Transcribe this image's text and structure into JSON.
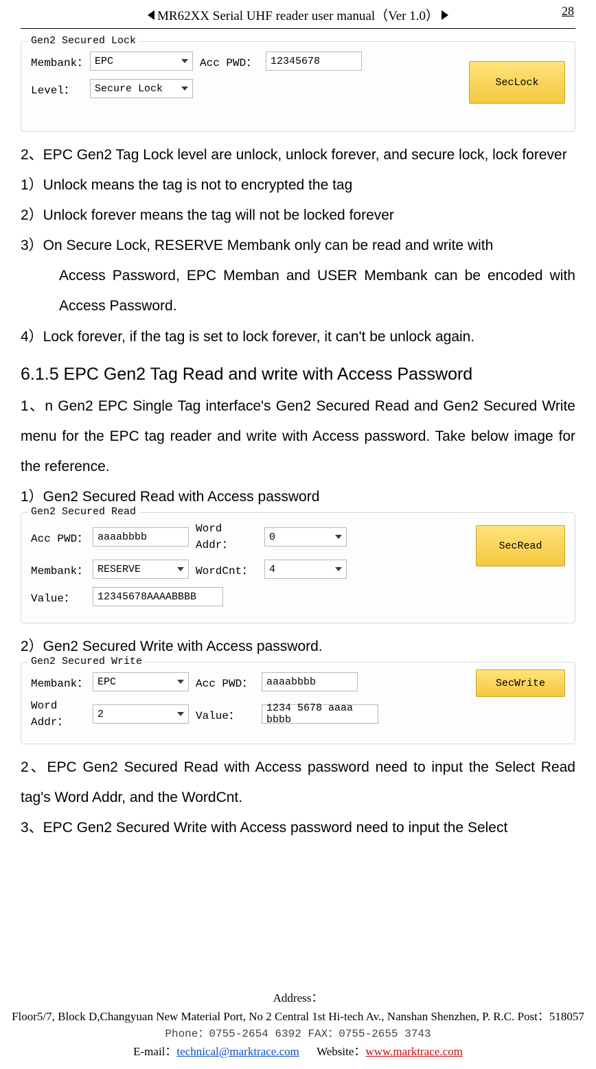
{
  "header": {
    "title": "MR62XX Serial UHF reader user manual（Ver 1.0）",
    "page": "28"
  },
  "panel_lock": {
    "legend": "Gen2 Secured Lock",
    "membank_label": "Membank：",
    "membank_value": "EPC",
    "accpwd_label": "Acc PWD：",
    "accpwd_value": "12345678",
    "level_label": "Level：",
    "level_value": "Secure Lock",
    "button": "SecLock"
  },
  "text": {
    "p1": "2、EPC Gen2 Tag Lock level are unlock, unlock forever, and secure lock, lock forever",
    "l1": "1）Unlock means the tag is not to encrypted the tag",
    "l2": "2）Unlock forever means the tag will not be locked forever",
    "l3a": "3）On Secure Lock, RESERVE Membank only can be read and write with",
    "l3b": "Access Password, EPC Memban and USER Membank can be encoded with Access Password.",
    "l4": "4）Lock forever, if the tag is set to lock forever, it can't be unlock again.",
    "h": "6.1.5 EPC Gen2 Tag Read and write with Access Password",
    "p2": "1、n Gen2 EPC Single Tag interface's Gen2 Secured Read and Gen2 Secured Write menu for the EPC tag reader and write with Access password. Take below image for the reference.",
    "s1": "1）Gen2 Secured Read with Access password",
    "s2": "2）Gen2 Secured Write with Access password.",
    "p3": "2、EPC Gen2 Secured Read with Access password need to input the Select Read tag's Word Addr, and the WordCnt.",
    "p4": "3、EPC Gen2 Secured Write with Access password need to input the Select"
  },
  "panel_read": {
    "legend": "Gen2 Secured Read",
    "accpwd_label": "Acc PWD：",
    "accpwd_value": "aaaabbbb",
    "wordaddr_label": "Word Addr：",
    "wordaddr_value": "0",
    "membank_label": "Membank：",
    "membank_value": "RESERVE",
    "wordcnt_label": "WordCnt：",
    "wordcnt_value": "4",
    "value_label": "Value：",
    "value_value": "12345678AAAABBBB",
    "button": "SecRead"
  },
  "panel_write": {
    "legend": "Gen2 Secured Write",
    "membank_label": "Membank：",
    "membank_value": "EPC",
    "accpwd_label": "Acc PWD：",
    "accpwd_value": "aaaabbbb",
    "wordaddr_label": "Word Addr：",
    "wordaddr_value": "2",
    "value_label": "Value：",
    "value_value": "1234 5678 aaaa bbbb",
    "button": "SecWrite"
  },
  "footer": {
    "addr_label": "Address：",
    "addr": "Floor5/7, Block D,Changyuan New  Material Port, No 2 Central 1st Hi-tech Av., Nanshan Shenzhen, P. R.C.   Post：518057",
    "phone_fax": "Phone：0755-2654 6392   FAX：0755-2655 3743",
    "email_label": "E-mail：",
    "email": "technical@marktrace.com",
    "website_label": "Website：",
    "website": "www.marktrace.com"
  }
}
